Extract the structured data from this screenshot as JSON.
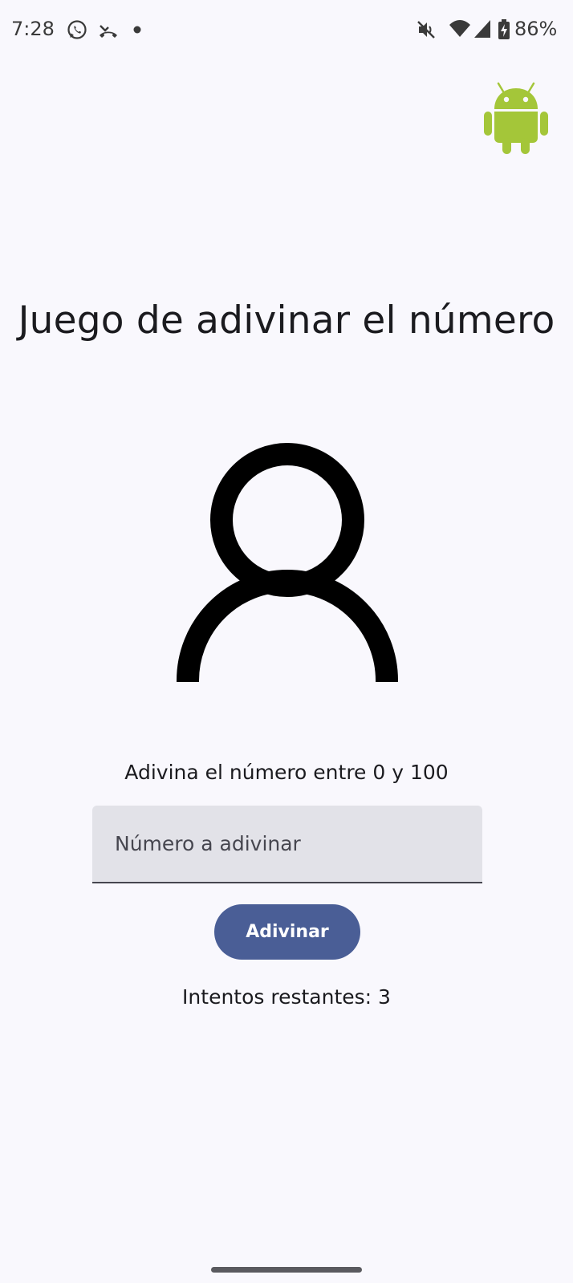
{
  "status_bar": {
    "time": "7:28",
    "battery_percent": "86%",
    "icons": [
      "whatsapp-icon",
      "missed-call-icon",
      "notification-dot-icon",
      "mute-icon",
      "wifi-icon",
      "cell-signal-icon",
      "battery-charging-icon"
    ]
  },
  "app": {
    "logo": "android-logo",
    "title": "Juego de adivinar el número",
    "avatar_icon": "person-icon",
    "prompt": "Adivina el número entre 0 y 100",
    "input_placeholder": "Número a adivinar",
    "input_value": "",
    "button_label": "Adivinar",
    "attempts_text": "Intentos restantes: 3"
  },
  "colors": {
    "background": "#f9f8fd",
    "button": "#4a5e96",
    "input_fill": "#e2e2e8",
    "android_green": "#a4c639"
  }
}
